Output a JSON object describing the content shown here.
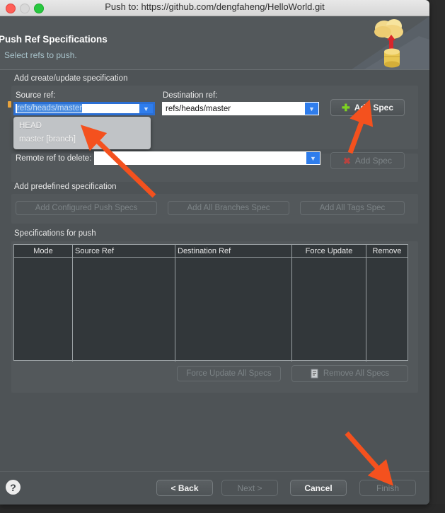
{
  "window": {
    "title": "Push to: https://github.com/dengfaheng/HelloWorld.git",
    "traffic_lights": [
      "close-red",
      "minimize-gray",
      "zoom-green"
    ]
  },
  "header": {
    "title": "Push Ref Specifications",
    "subtitle": "Select refs to push.",
    "art": "cloud-upload-database-icon"
  },
  "create_update_group": {
    "label": "Add create/update specification",
    "source_ref": {
      "label": "Source ref:",
      "value": "refs/heads/master",
      "selected": true,
      "dropdown_open": true,
      "options": [
        "HEAD",
        "master [branch]"
      ]
    },
    "destination_ref": {
      "label": "Destination ref:",
      "value": "refs/heads/master"
    },
    "add_spec_button": "Add Spec",
    "add_spec_icon": "plus-icon"
  },
  "delete_group": {
    "label": "Remote ref to delete:",
    "value": "",
    "add_spec_button": "Add Spec",
    "add_spec_icon": "x-icon",
    "disabled": true
  },
  "predefined_group": {
    "label": "Add predefined specification",
    "buttons": [
      "Add Configured Push Specs",
      "Add All Branches Spec",
      "Add All Tags Spec"
    ]
  },
  "specs_table": {
    "label": "Specifications for push",
    "columns": [
      "Mode",
      "Source Ref",
      "Destination Ref",
      "Force Update",
      "Remove"
    ],
    "rows": [],
    "force_update_all_button": "Force Update All Specs",
    "remove_all_button": "Remove All Specs",
    "remove_all_icon": "document-remove-icon"
  },
  "footer": {
    "help_icon": "question-mark-icon",
    "buttons": [
      {
        "label": "< Back",
        "enabled": true
      },
      {
        "label": "Next >",
        "enabled": false
      },
      {
        "label": "Cancel",
        "enabled": true
      },
      {
        "label": "Finish",
        "enabled": false
      }
    ]
  },
  "annotations": {
    "arrow_color": "#f4511e",
    "arrows": [
      {
        "name": "arrow-to-add-spec"
      },
      {
        "name": "arrow-to-dropdown-option"
      },
      {
        "name": "arrow-to-finish"
      }
    ]
  },
  "colors": {
    "window_bg": "#4e5356",
    "group_bg": "#53585b",
    "accent_blue": "#2f7dec",
    "link_text": "#a9c4cc",
    "annotation": "#f4511e"
  }
}
